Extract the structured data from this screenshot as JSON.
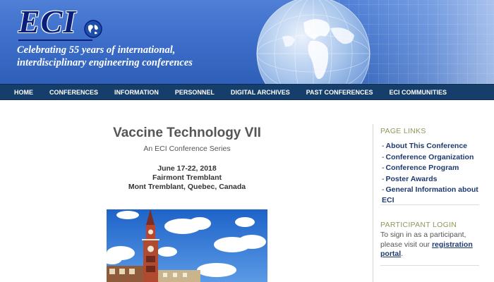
{
  "banner": {
    "logo_text": "ECI",
    "tagline_line1": "Celebrating 55 years of international,",
    "tagline_line2": "interdisciplinary engineering conferences"
  },
  "nav": {
    "items": [
      "HOME",
      "CONFERENCES",
      "INFORMATION",
      "PERSONNEL",
      "DIGITAL ARCHIVES",
      "PAST CONFERENCES",
      "ECI COMMUNITIES"
    ]
  },
  "conference": {
    "title": "Vaccine Technology VII",
    "series": "An ECI Conference Series",
    "dates": "June 17-22, 2018",
    "venue": "Fairmont Tremblant",
    "location": "Mont Tremblant, Quebec, Canada"
  },
  "sidebar": {
    "page_links_heading": "PAGE LINKS",
    "page_links": [
      "About This Conference",
      "Conference Organization",
      "Conference Program",
      "Poster Awards",
      "General Information about ECI"
    ],
    "participant_heading": "PARTICIPANT LOGIN",
    "login_text_line1": "To sign in as a participant,",
    "login_text_line2": "please visit our",
    "login_link_part1": "registration",
    "login_link_part2": "portal",
    "login_text_end": "."
  },
  "colors": {
    "banner_blue": "#3d6fcb",
    "nav_bg": "#163e6b",
    "link": "#1c3a6e",
    "heading_olive": "#8a9a5a"
  }
}
